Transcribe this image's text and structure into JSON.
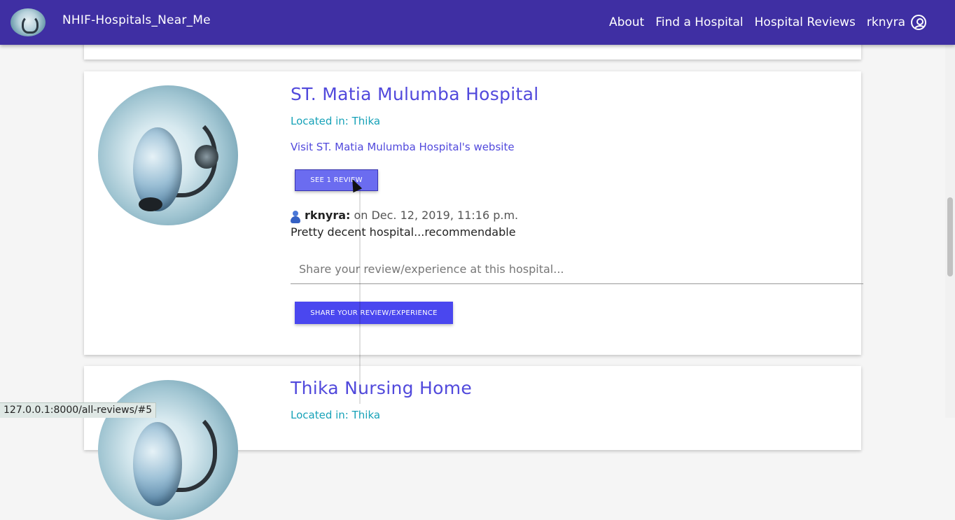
{
  "navbar": {
    "brand": "NHIF-Hospitals_Near_Me",
    "links": [
      "About",
      "Find a Hospital",
      "Hospital Reviews"
    ],
    "username": "rknyra",
    "icon": "user-circle-icon"
  },
  "hospital": {
    "name": "ST. Matia Mulumba Hospital",
    "located": "Located in: Thika",
    "website": "Visit ST. Matia Mulumba Hospital's website",
    "see_reviews_label": "SEE 1 REVIEW",
    "review": {
      "user": "rknyra:",
      "date": "on Dec. 12, 2019, 11:16 p.m.",
      "text": "Pretty decent hospital...recommendable"
    },
    "review_placeholder": "Share your review/experience at this hospital...",
    "share_label": "SHARE YOUR REVIEW/EXPERIENCE"
  },
  "next_hospital": {
    "name": "Thika Nursing Home",
    "located": "Located in: Thika"
  },
  "status_url": "127.0.0.1:8000/all-reviews/#5"
}
